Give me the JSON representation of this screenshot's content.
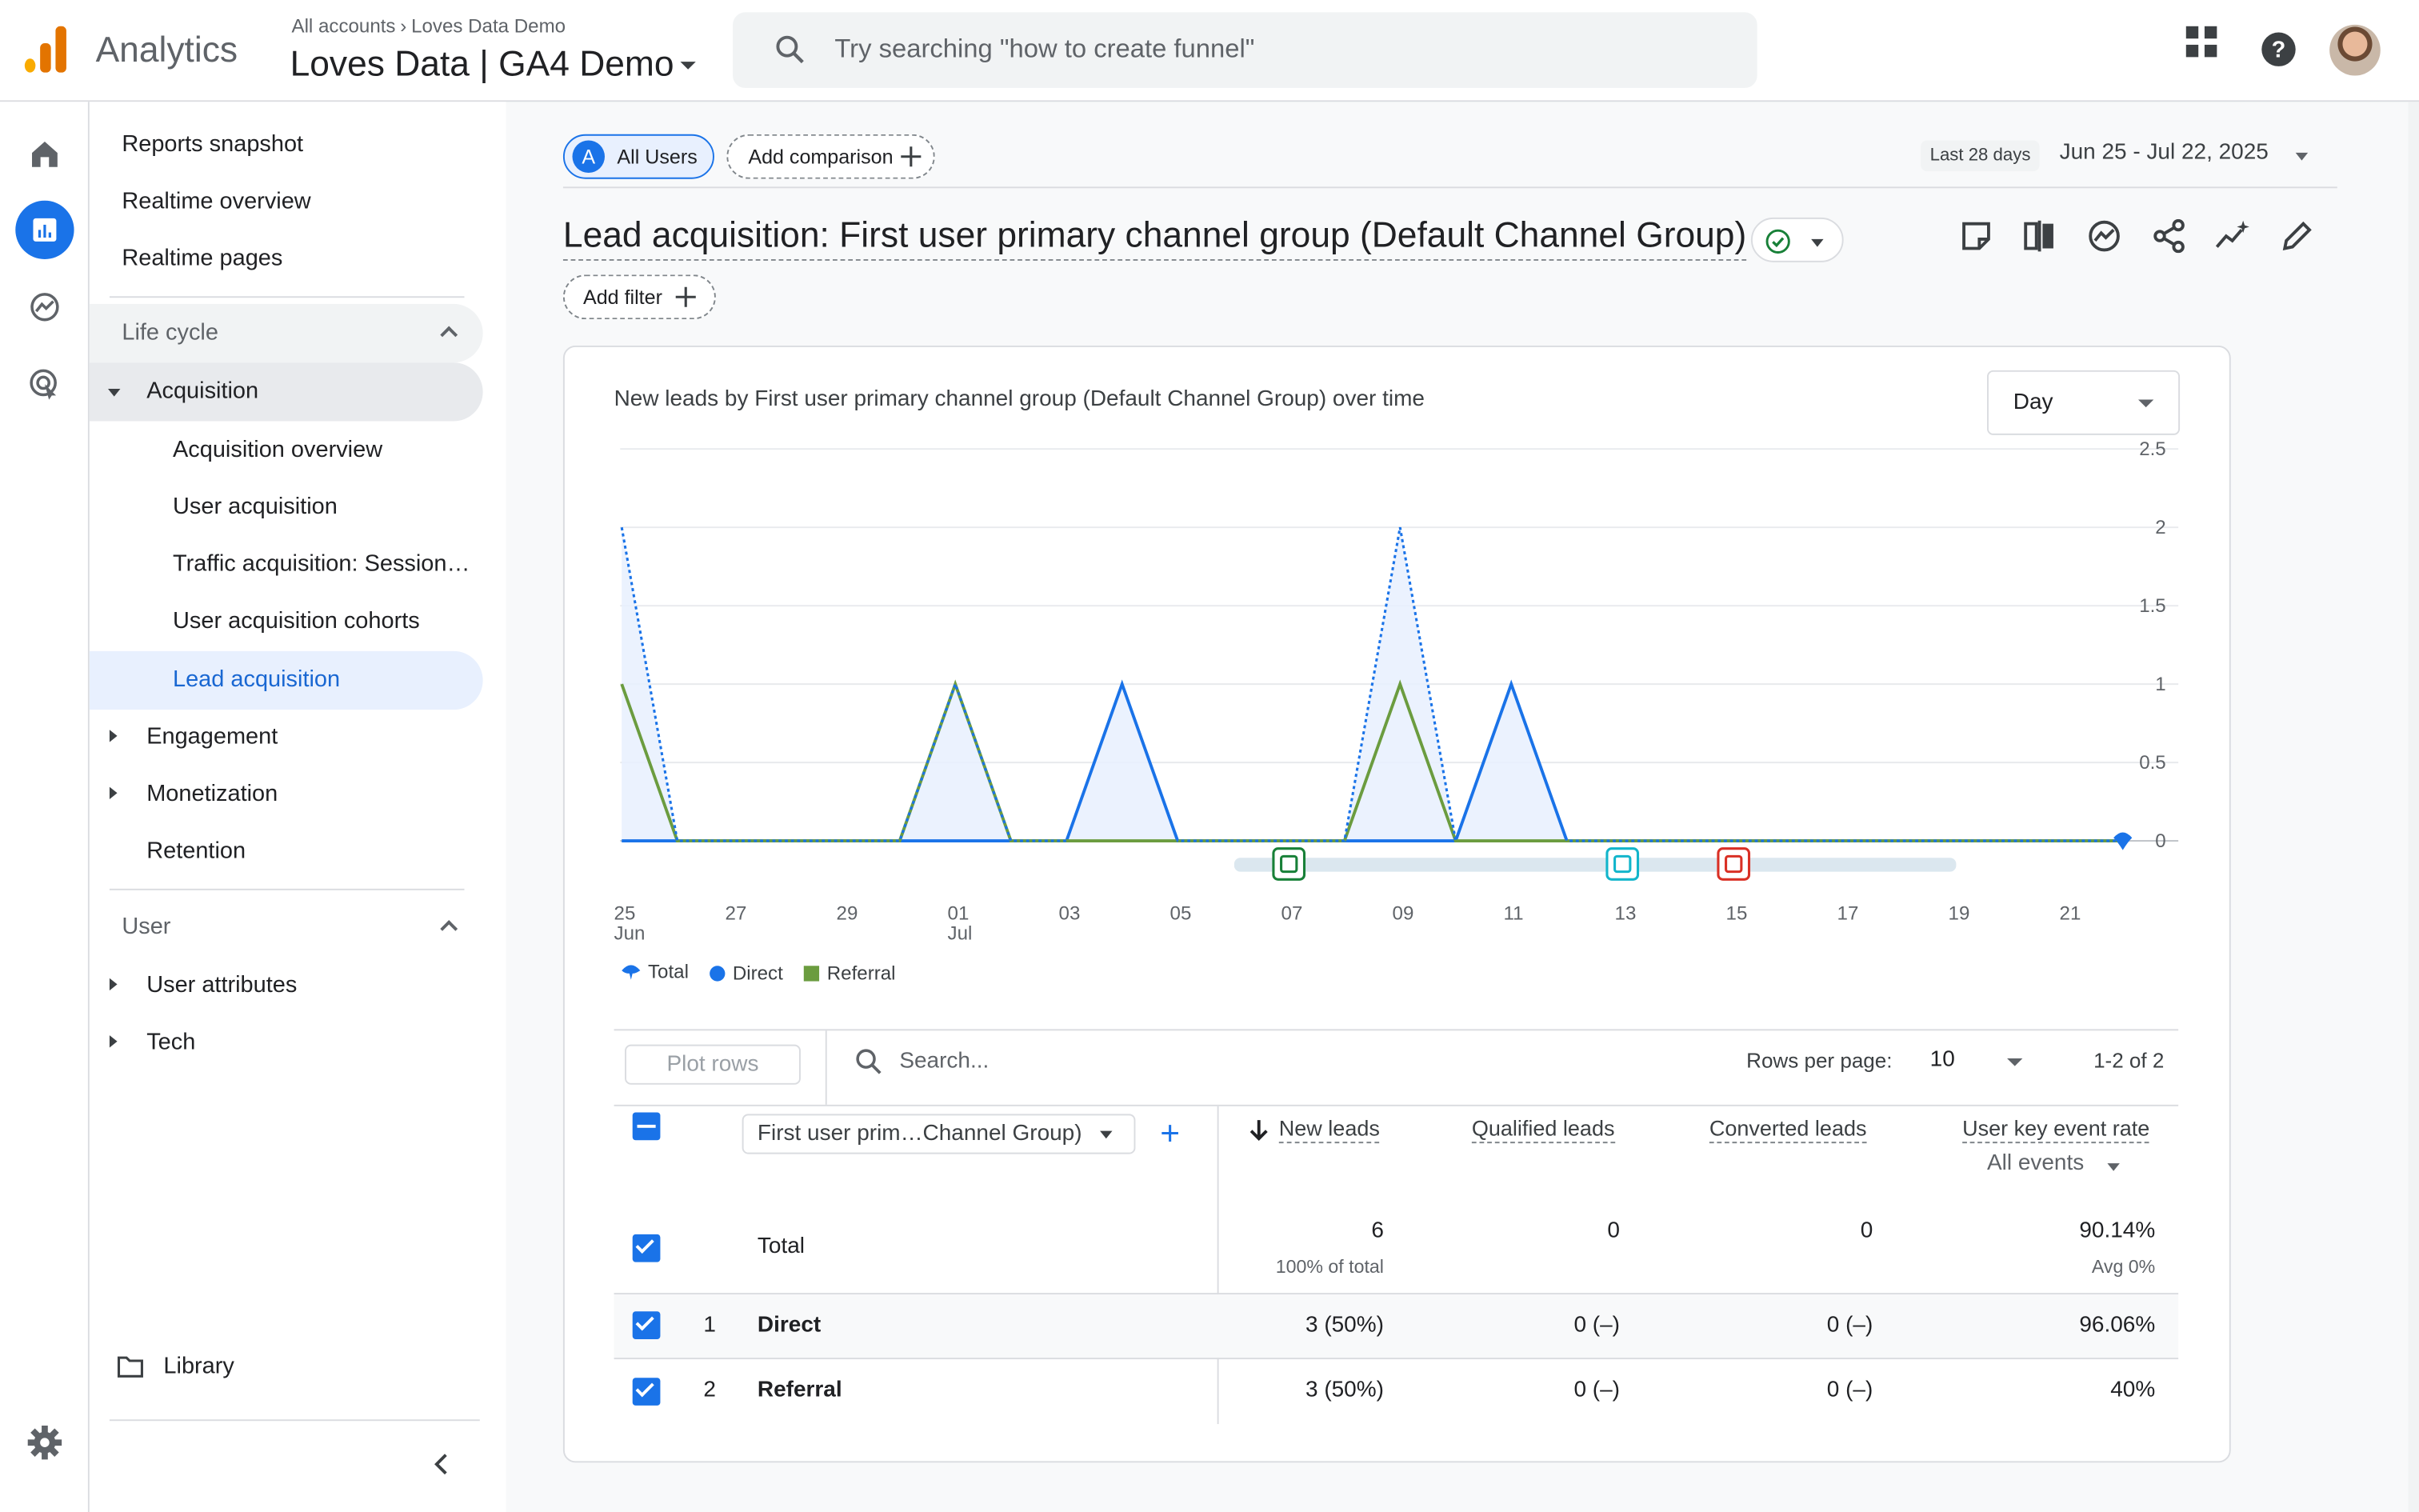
{
  "header": {
    "app_name": "Analytics",
    "breadcrumb": [
      "All accounts",
      "Loves Data Demo"
    ],
    "property": "Loves Data | GA4 Demo",
    "search_placeholder": "Try searching \"how to create funnel\""
  },
  "nav": {
    "top_items": [
      "Reports snapshot",
      "Realtime overview",
      "Realtime pages"
    ],
    "lifecycle_header": "Life cycle",
    "acquisition": "Acquisition",
    "acquisition_items": [
      "Acquisition overview",
      "User acquisition",
      "Traffic acquisition: Session…",
      "User acquisition cohorts",
      "Lead acquisition"
    ],
    "other_lifecycle": [
      "Engagement",
      "Monetization",
      "Retention"
    ],
    "user_header": "User",
    "user_items": [
      "User attributes",
      "Tech"
    ],
    "library": "Library"
  },
  "toolbar": {
    "segment_letter": "A",
    "segment": "All Users",
    "add_comparison": "Add comparison",
    "date_badge": "Last 28 days",
    "date_range": "Jun 25 - Jul 22, 2025",
    "title": "Lead acquisition: First user primary channel group (Default Channel Group)",
    "add_filter": "Add filter"
  },
  "chart_card": {
    "title": "New leads by First user primary channel group (Default Channel Group) over time",
    "granularity": "Day"
  },
  "chart_data": {
    "type": "line",
    "x": [
      "25 Jun",
      "26",
      "27",
      "28",
      "29",
      "30",
      "01 Jul",
      "02",
      "03",
      "04",
      "05",
      "06",
      "07",
      "08",
      "09",
      "10",
      "11",
      "12",
      "13",
      "14",
      "15",
      "16",
      "17",
      "18",
      "19",
      "20",
      "21",
      "22"
    ],
    "x_tick_labels": [
      {
        "top": "25",
        "bottom": "Jun"
      },
      {
        "top": "27",
        "bottom": ""
      },
      {
        "top": "29",
        "bottom": ""
      },
      {
        "top": "01",
        "bottom": "Jul"
      },
      {
        "top": "03",
        "bottom": ""
      },
      {
        "top": "05",
        "bottom": ""
      },
      {
        "top": "07",
        "bottom": ""
      },
      {
        "top": "09",
        "bottom": ""
      },
      {
        "top": "11",
        "bottom": ""
      },
      {
        "top": "13",
        "bottom": ""
      },
      {
        "top": "15",
        "bottom": ""
      },
      {
        "top": "17",
        "bottom": ""
      },
      {
        "top": "19",
        "bottom": ""
      },
      {
        "top": "21",
        "bottom": ""
      }
    ],
    "series": [
      {
        "name": "Total",
        "color": "#1a73e8",
        "values": [
          2,
          0,
          0,
          0,
          0,
          0,
          1,
          0,
          0,
          1,
          0,
          0,
          0,
          0,
          2,
          0,
          1,
          0,
          0,
          0,
          0,
          0,
          0,
          0,
          0,
          0,
          0,
          0
        ]
      },
      {
        "name": "Direct",
        "color": "#1a73e8",
        "values": [
          0,
          0,
          0,
          0,
          0,
          0,
          0,
          0,
          0,
          1,
          0,
          0,
          0,
          0,
          0,
          0,
          1,
          0,
          0,
          0,
          0,
          0,
          0,
          0,
          0,
          0,
          0,
          0
        ]
      },
      {
        "name": "Referral",
        "color": "#6b9c3f",
        "values": [
          1,
          0,
          0,
          0,
          0,
          0,
          1,
          0,
          0,
          0,
          0,
          0,
          0,
          0,
          1,
          0,
          0,
          0,
          0,
          0,
          0,
          0,
          0,
          0,
          0,
          0,
          0,
          0
        ]
      }
    ],
    "y_ticks": [
      "0",
      "0.5",
      "1",
      "1.5",
      "2",
      "2.5"
    ],
    "ylim": [
      0,
      2.5
    ],
    "annotations": [
      {
        "day": "07",
        "color": "#188038"
      },
      {
        "day": "13",
        "color": "#12b5cb"
      },
      {
        "day": "15",
        "color": "#d93025"
      }
    ],
    "legend": "bottom-left"
  },
  "table": {
    "plot_rows": "Plot rows",
    "search_placeholder": "Search...",
    "rows_per_page_label": "Rows per page:",
    "rows_per_page": "10",
    "pager": "1-2 of 2",
    "dimension": "First user prim…Channel Group)",
    "metrics": [
      "New leads",
      "Qualified leads",
      "Converted leads",
      "User key event rate"
    ],
    "key_event": "All events",
    "total": {
      "label": "Total",
      "new_leads": "6",
      "new_leads_sub": "100% of total",
      "qualified": "0",
      "converted": "0",
      "rate": "90.14%",
      "rate_sub": "Avg 0%"
    },
    "rows": [
      {
        "index": "1",
        "name": "Direct",
        "new_leads": "3 (50%)",
        "qualified": "0 (–)",
        "converted": "0 (–)",
        "rate": "96.06%"
      },
      {
        "index": "2",
        "name": "Referral",
        "new_leads": "3 (50%)",
        "qualified": "0 (–)",
        "converted": "0 (–)",
        "rate": "40%"
      }
    ]
  }
}
